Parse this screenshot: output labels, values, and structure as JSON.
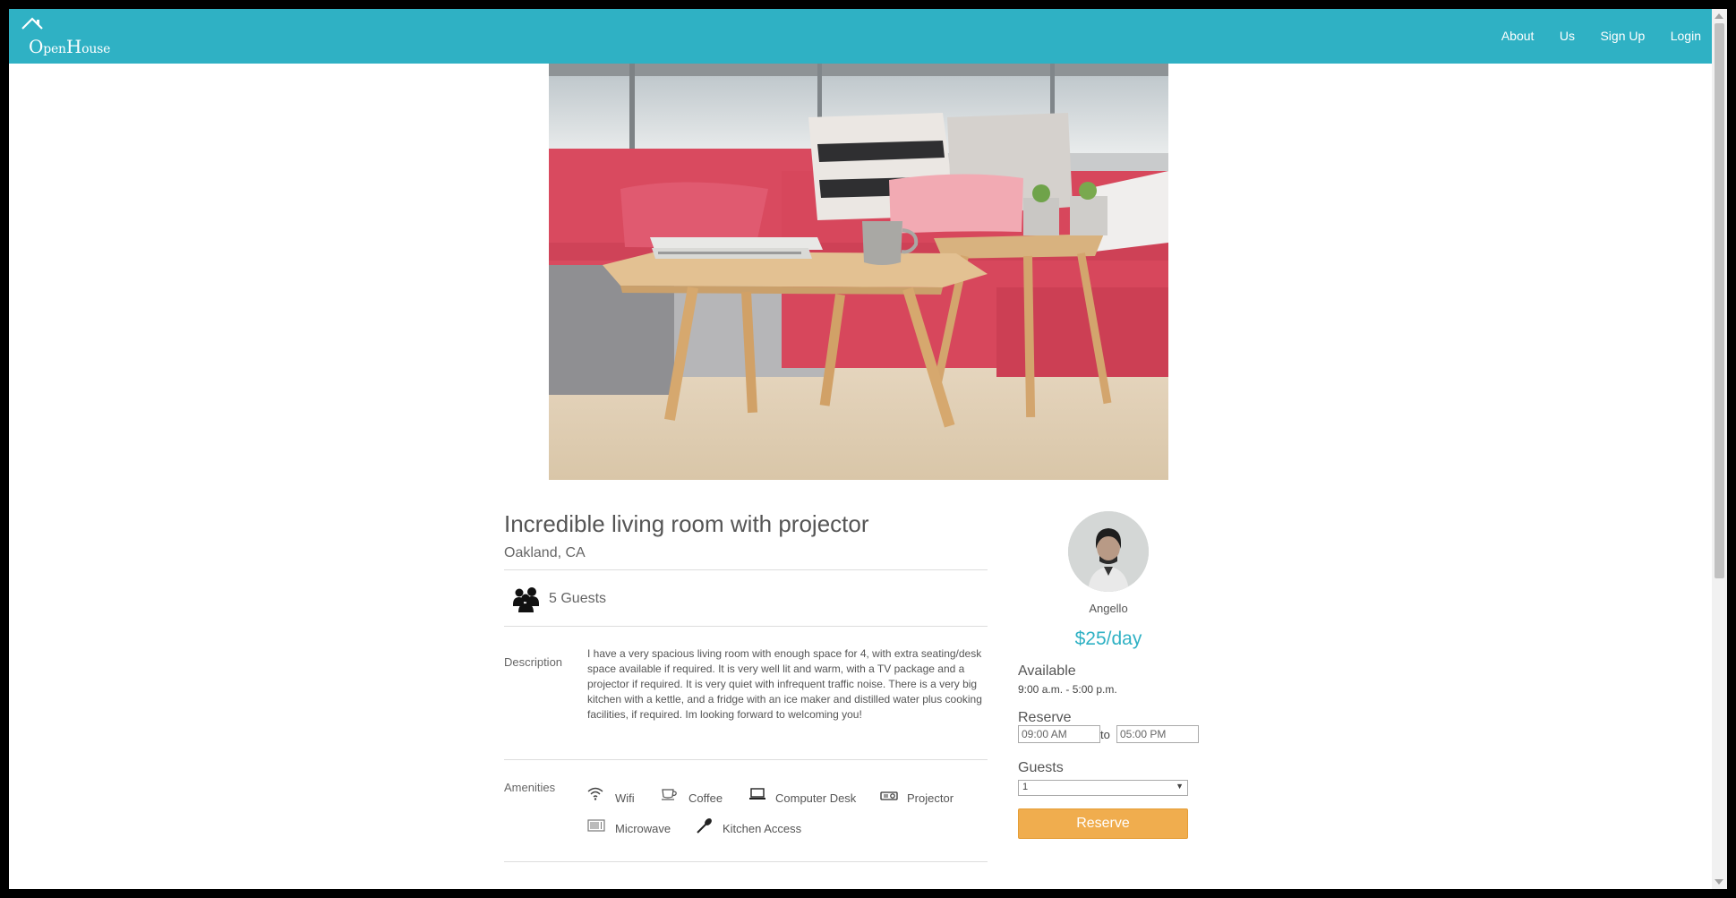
{
  "nav": {
    "logo_first_letter": "O",
    "logo_first_rest": "pen",
    "logo_second_letter": "H",
    "logo_second_rest": "ouse",
    "links": [
      "About",
      "Us",
      "Sign Up",
      "Login"
    ]
  },
  "listing": {
    "title": "Incredible living room with projector",
    "location": "Oakland, CA",
    "guests": "5 Guests",
    "description_label": "Description",
    "description": "I have a very spacious living room with enough space for 4, with extra seating/desk space available if required. It is very well lit and warm, with a TV package and a projector if required. It is very quiet with infrequent traffic noise. There is a very big kitchen with a kettle, and a fridge with an ice maker and distilled water plus cooking facilities, if required. Im looking forward to welcoming you!",
    "amenities_label": "Amenities",
    "amenities": [
      {
        "label": "Wifi",
        "icon": "wifi-icon"
      },
      {
        "label": "Coffee",
        "icon": "coffee-icon"
      },
      {
        "label": "Computer Desk",
        "icon": "laptop-icon"
      },
      {
        "label": "Projector",
        "icon": "projector-icon"
      },
      {
        "label": "Microwave",
        "icon": "microwave-icon"
      },
      {
        "label": "Kitchen Access",
        "icon": "kitchen-utensil-icon"
      }
    ]
  },
  "booking": {
    "host_name": "Angello",
    "price": "$25/day",
    "available_heading": "Available",
    "available_time": "9:00 a.m. - 5:00 p.m.",
    "reserve_heading": "Reserve",
    "start_time": "09:00 AM",
    "to_label": "to",
    "end_time": "05:00 PM",
    "guests_heading": "Guests",
    "guests_value": "1",
    "reserve_button": "Reserve"
  },
  "colors": {
    "brand": "#2fb1c4",
    "button": "#f0ad4e"
  }
}
